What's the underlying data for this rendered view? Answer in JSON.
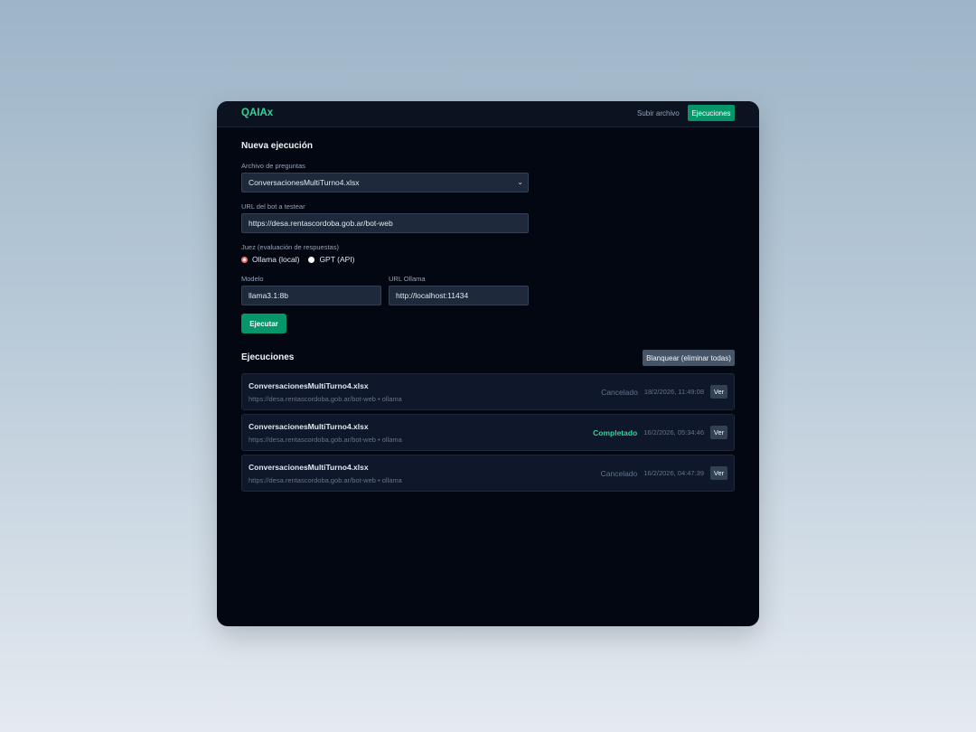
{
  "header": {
    "brand": "QAIAx",
    "nav_upload": "Subir archivo",
    "nav_runs": "Ejecuciones"
  },
  "form": {
    "title": "Nueva ejecución",
    "file_label": "Archivo de preguntas",
    "file_value": "ConversacionesMultiTurno4.xlsx",
    "url_label": "URL del bot a testear",
    "url_value": "https://desa.rentascordoba.gob.ar/bot-web",
    "judge_label": "Juez (evaluación de respuestas)",
    "judge_options": [
      {
        "label": "Ollama (local)",
        "selected": true
      },
      {
        "label": "GPT (API)",
        "selected": false
      }
    ],
    "model_label": "Modelo",
    "model_value": "llama3.1:8b",
    "ollama_url_label": "URL Ollama",
    "ollama_url_value": "http://localhost:11434",
    "submit_label": "Ejecutar"
  },
  "runs": {
    "title": "Ejecuciones",
    "clear_label": "Blanquear (eliminar todas)",
    "items": [
      {
        "file": "ConversacionesMultiTurno4.xlsx",
        "url": "https://desa.rentascordoba.gob.ar/bot-web",
        "judge": "• ollama",
        "status": "Cancelado",
        "date": "18/2/2026, 11:49:08",
        "view": "Ver"
      },
      {
        "file": "ConversacionesMultiTurno4.xlsx",
        "url": "https://desa.rentascordoba.gob.ar/bot-web",
        "judge": "• ollama",
        "status": "Completado",
        "date": "16/2/2026, 05:34:46",
        "view": "Ver"
      },
      {
        "file": "ConversacionesMultiTurno4.xlsx",
        "url": "https://desa.rentascordoba.gob.ar/bot-web",
        "judge": "• ollama",
        "status": "Cancelado",
        "date": "16/2/2026, 04:47:39",
        "view": "Ver"
      }
    ]
  },
  "colors": {
    "accent": "#059669",
    "brand": "#34d399",
    "window_bg": "#030712",
    "status_cancelled": "#64748b",
    "status_completed": "#34d399",
    "radio_selected": "#f87171"
  },
  "icons": {
    "select_arrow": "chevron-down-icon"
  }
}
